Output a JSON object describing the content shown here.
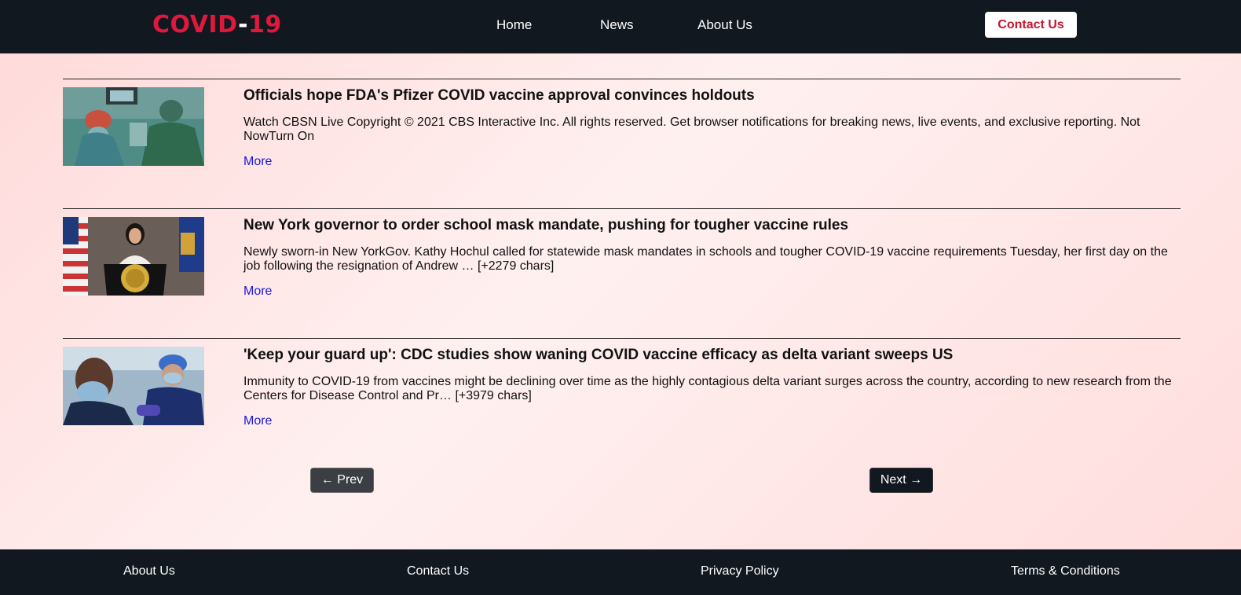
{
  "header": {
    "logo_main": "COVID",
    "logo_dash": "-",
    "logo_num": "19",
    "nav": [
      "Home",
      "News",
      "About Us"
    ],
    "contact_label": "Contact Us"
  },
  "articles": [
    {
      "title": "Officials hope FDA's Pfizer COVID vaccine approval convinces holdouts",
      "description": "Watch CBSN Live Copyright © 2021 CBS Interactive Inc. All rights reserved. Get browser notifications for breaking news, live events, and exclusive reporting. Not NowTurn On",
      "more_label": "More"
    },
    {
      "title": "New York governor to order school mask mandate, pushing for tougher vaccine rules",
      "description": "Newly sworn-in New YorkGov. Kathy Hochul called for statewide mask mandates in schools and tougher COVID-19 vaccine requirements Tuesday, her first day on the job following the resignation of Andrew … [+2279 chars]",
      "more_label": "More"
    },
    {
      "title": "'Keep your guard up': CDC studies show waning COVID vaccine efficacy as delta variant sweeps US",
      "description": "Immunity to COVID-19 from vaccines might be declining over time as the highly contagious delta variant surges across the country, according to new research from the Centers for Disease Control and Pr… [+3979 chars]",
      "more_label": "More"
    }
  ],
  "pagination": {
    "prev_label": "← Prev",
    "next_label": "Next →"
  },
  "footer": {
    "links": [
      "About Us",
      "Contact Us",
      "Privacy Policy",
      "Terms & Conditions"
    ]
  },
  "colors": {
    "brand_red": "#e0183c",
    "nav_bg": "#111820",
    "link_blue": "#1a1adc"
  }
}
